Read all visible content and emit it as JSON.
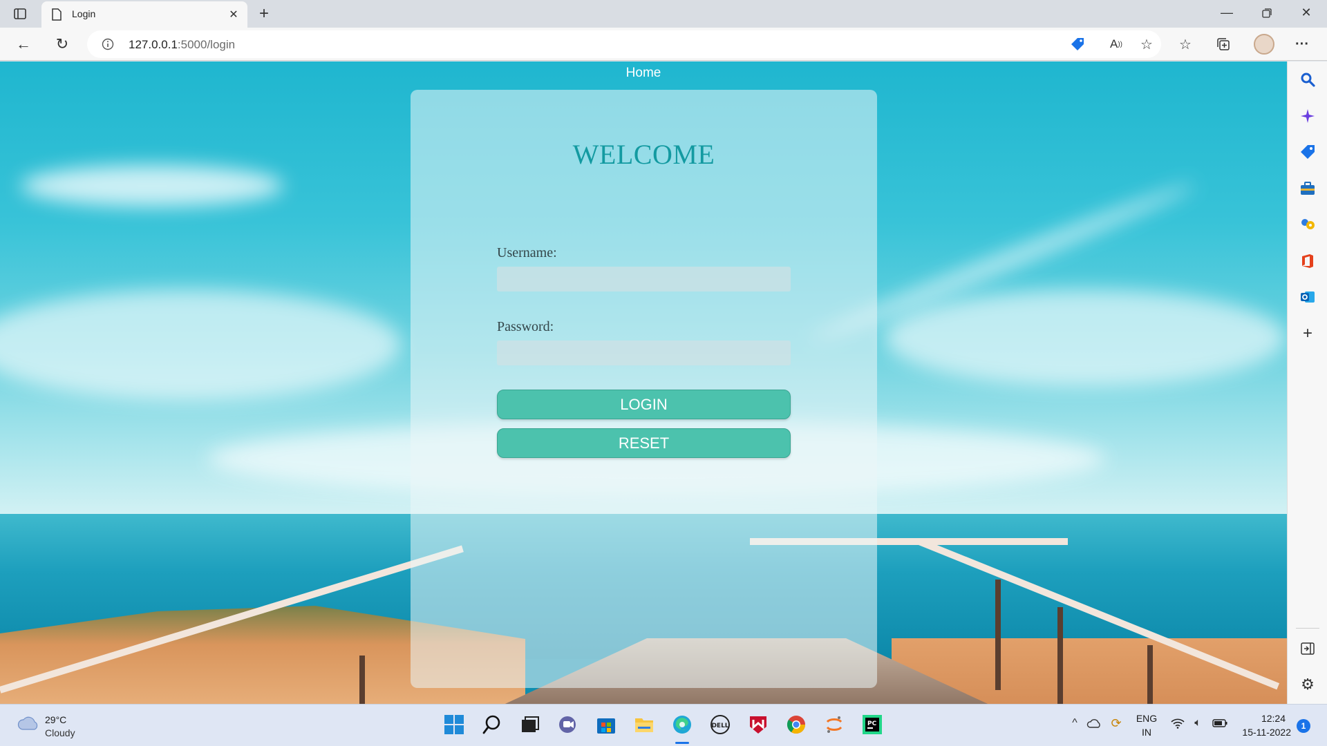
{
  "browser": {
    "tab_title": "Login",
    "url_host": "127.0.0.1",
    "url_path": ":5000/login"
  },
  "page": {
    "nav_home": "Home",
    "card": {
      "title": "WELCOME",
      "username_label": "Username:",
      "username_value": "",
      "password_label": "Password:",
      "password_value": "",
      "login_label": "LOGIN",
      "reset_label": "RESET"
    }
  },
  "colors": {
    "title": "#139aa1",
    "button": "#4cc2ad"
  },
  "taskbar": {
    "weather_temp": "29°C",
    "weather_desc": "Cloudy",
    "lang_top": "ENG",
    "lang_bottom": "IN",
    "time": "12:24",
    "date": "15-11-2022",
    "notification_count": "1"
  }
}
